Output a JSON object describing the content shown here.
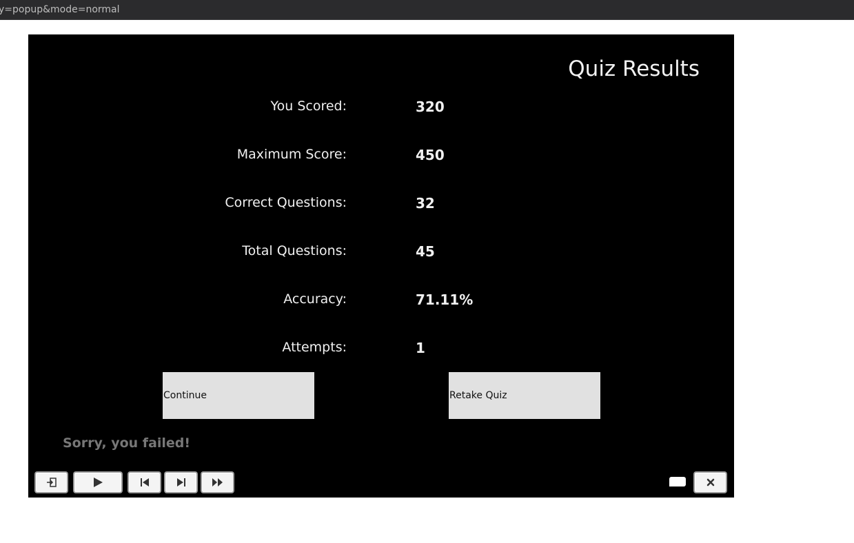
{
  "browser": {
    "url_fragment": "y=popup&mode=normal"
  },
  "quiz": {
    "title": "Quiz Results",
    "rows": [
      {
        "label": "You Scored:",
        "value": "320"
      },
      {
        "label": "Maximum Score:",
        "value": "450"
      },
      {
        "label": "Correct Questions:",
        "value": "32"
      },
      {
        "label": "Total Questions:",
        "value": "45"
      },
      {
        "label": "Accuracy:",
        "value": "71.11%"
      },
      {
        "label": "Attempts:",
        "value": "1"
      }
    ],
    "continue_label": "Continue",
    "retake_label": "Retake Quiz",
    "result_message": "Sorry, you failed!"
  },
  "playbar": {
    "icons": [
      "exit-icon",
      "play-icon",
      "rewind-icon",
      "next-slide-icon",
      "fast-forward-icon",
      "closed-caption-icon",
      "close-icon"
    ]
  },
  "colors": {
    "stage_background": "#000000",
    "text": "#f0f0f0",
    "button_background": "#e1e1e1",
    "fail_text": "#777777"
  }
}
